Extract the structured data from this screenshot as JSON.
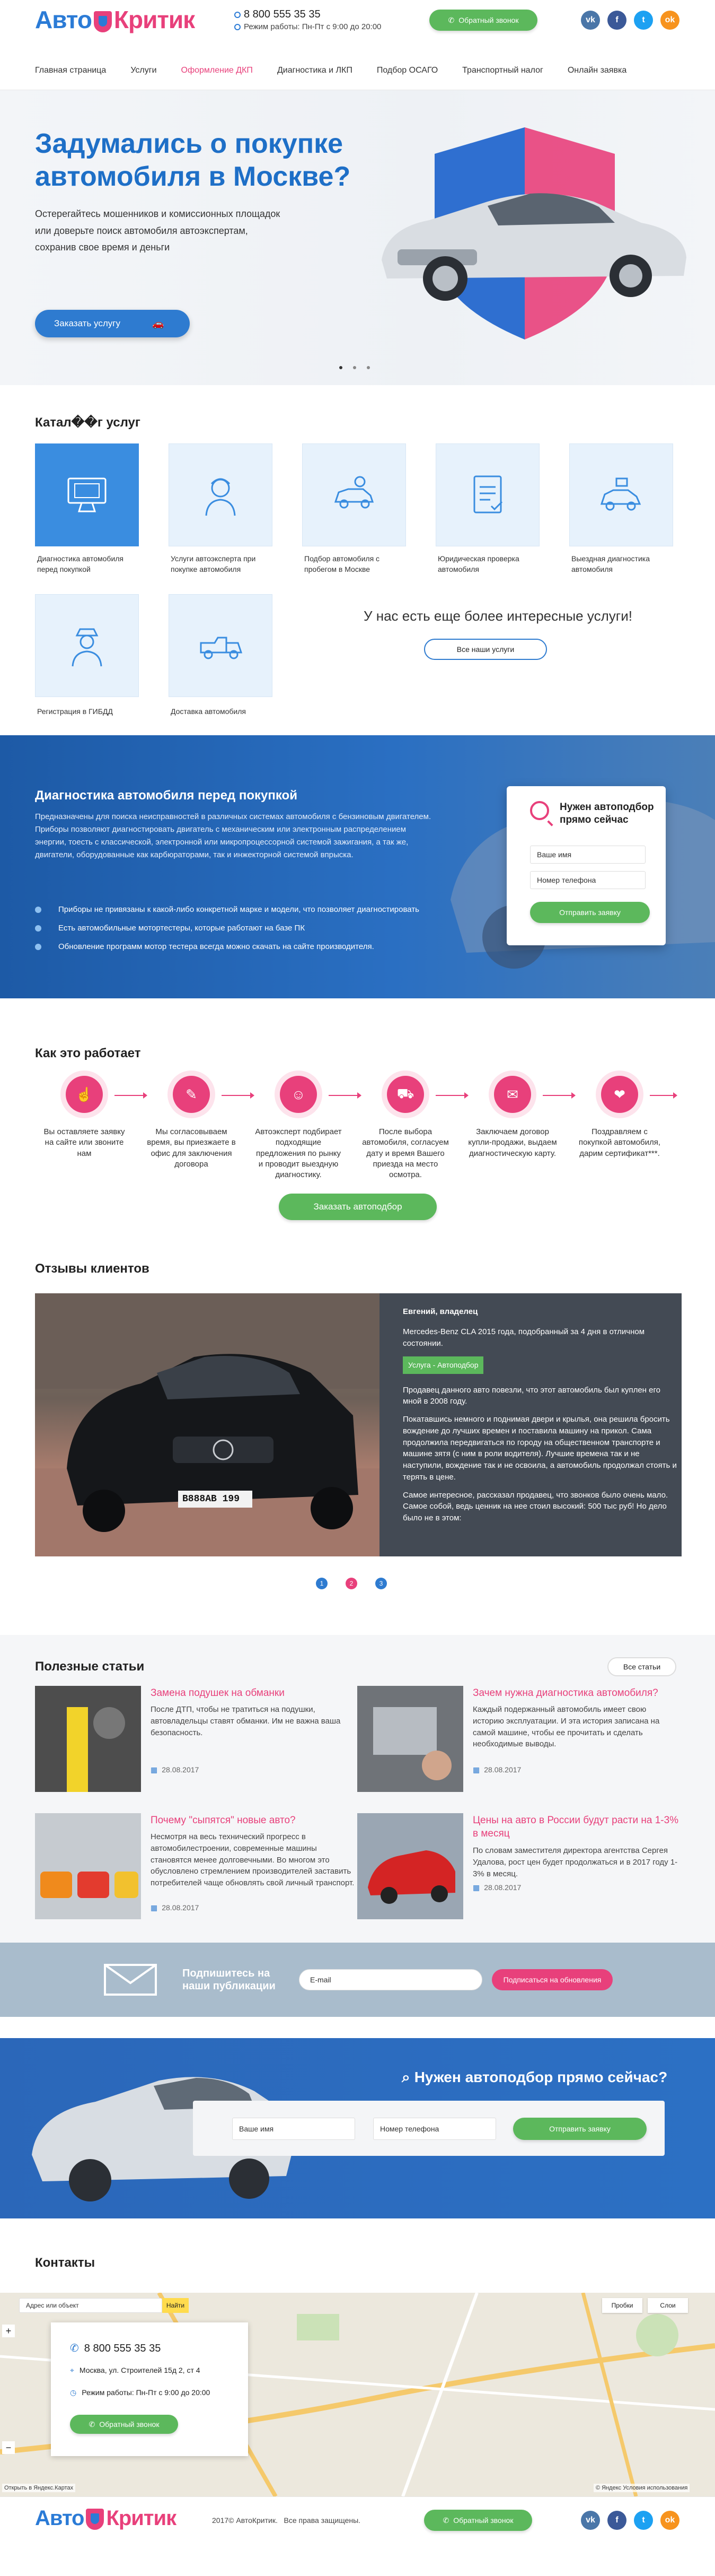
{
  "brand": {
    "part1": "Авто",
    "part2": "Критик"
  },
  "header": {
    "phone": "8 800 555 35 35",
    "hours": "Режим работы: Пн-Пт с 9:00 до 20:00",
    "callback": "Обратный звонок"
  },
  "social": [
    {
      "label": "vk",
      "color": "#4a76a8"
    },
    {
      "label": "f",
      "color": "#3b5998"
    },
    {
      "label": "t",
      "color": "#1da1f2"
    },
    {
      "label": "ok",
      "color": "#f7931e"
    }
  ],
  "nav": [
    "Главная страница",
    "Услуги",
    "Оформление ДКП",
    "Диагностика и ЛКП",
    "Подбор ОСАГО",
    "Транспортный налог",
    "Онлайн заявка"
  ],
  "nav_active": 2,
  "hero": {
    "title": "Задумались о покупке автомобиля в Москве?",
    "text": "Остерегайтесь мошенников и комиссионных площадок или доверьте поиск автомобиля автоэкспертам, сохранив свое время и деньги",
    "button": "Заказать услугу"
  },
  "catalog": {
    "title": "Катал��г услуг",
    "items": [
      "Диагностика автомобиля перед покупкой",
      "Услуги автоэксперта при покупке автомобиля",
      "Подбор автомобиля с пробегом в Москве",
      "Юридическая проверка автомобиля",
      "Выездная диагностика автомобиля",
      "Регистрация в ГИБДД",
      "Доставка автомобиля"
    ],
    "more_text": "У нас есть еще более интересные услуги!",
    "more_button": "Все наши услуги"
  },
  "diag": {
    "title": "Диагностика автомобиля перед покупкой",
    "text": "Предназначены для поиска неисправностей в различных системах автомобиля с бензиновым двигателем. Приборы позволяют диагностировать двигатель с механическим или электронным распределением энергии, тоесть с классической, электронной или микропроцессорной системой зажигания, а так же, двигатели, оборудованные как карбюраторами, так и инжекторной системой впрыска.",
    "bullets": [
      "Приборы не привязаны к какой-либо конкретной марке и модели, что позволяет диагностировать",
      "Есть автомобильные мотортестеры, которые работают на базе ПК",
      "Обновление программ мотор тестера всегда можно скачать на сайте производителя."
    ],
    "form_title": "Нужен автоподбор прямо сейчас",
    "name_ph": "Ваше имя",
    "phone_ph": "Номер телефона",
    "submit": "Отправить заявку"
  },
  "how": {
    "title": "Как это работает",
    "steps": [
      "Вы оставляете заявку на сайте или звоните нам",
      "Мы согласовываем время, вы приезжаете в офис для заключения договора",
      "Автоэксперт подбирает подходящие предложения по рынку и проводит выездную диагностику.",
      "После выбора автомобиля, согласуем дату и время Вашего приезда на место осмотра.",
      "Заключаем договор купли-продажи, выдаем диагностическую карту.",
      "Поздравляем с покупкой автомобиля, дарим сертификат***."
    ],
    "button": "Заказать автоподбор"
  },
  "reviews": {
    "title": "Отзывы клиентов",
    "author": "Евгений, владелец",
    "subtitle": "Mercedes-Benz CLA 2015 года, подобранный за 4 дня в отличном состоянии.",
    "service": "Услуга - Автоподбор",
    "paragraphs": [
      "Продавец данного авто повезли, что этот автомобиль был куплен его мной в 2008 году.",
      "Покатавшись немного и поднимая двери и крылья, она решила бросить вождение до лучших времен и поставила машину на прикол. Сама продолжила передвигаться по городу на общественном транспорте и машине зятя (с ним в роли водителя). Лучшие времена так и не наступили, вождение так и не освоила, а автомобиль продолжал стоять и терять в цене.",
      "Самое интересное, рассказал продавец, что звонков было очень мало. Самое собой, ведь ценник на нее стоил высокий: 500 тыс руб! Но дело было не в этом:"
    ],
    "plate": "В888АВ 199",
    "pages": [
      "1",
      "2",
      "3"
    ]
  },
  "articles": {
    "title": "Полезные статьи",
    "all": "Все статьи",
    "items": [
      {
        "title": "Замена подушек на обманки",
        "text": "После ДТП, чтобы не тратиться на подушки, автовладельцы ставят обманки. Им не важна ваша безопасность.",
        "date": "28.08.2017"
      },
      {
        "title": "Зачем нужна диагностика автомобиля?",
        "text": "Каждый подержанный автомобиль имеет свою историю эксплуатации. И эта история записана на самой машине, чтобы ее прочитать и сделать необходимые выводы.",
        "date": "28.08.2017"
      },
      {
        "title": "Почему \"сыпятся\" новые авто?",
        "text": "Несмотря на весь технический прогресс в автомобилестроении, современные машины становятся менее долговечными. Во многом это обусловлено стремлением производителей заставить потребителей чаще обновлять свой личный транспорт.",
        "date": "28.08.2017"
      },
      {
        "title": "Цены на авто в России будут расти на 1-3% в месяц",
        "text": "По словам заместителя директора агентства Сергея Удалова, рост цен будет продолжаться и в 2017 году 1-3% в месяц.",
        "date": "28.08.2017"
      }
    ]
  },
  "subscribe": {
    "text": "Подпишитесь на наши публикации",
    "email_ph": "E-mail",
    "button": "Подписаться на обновления"
  },
  "cta": {
    "title": "Нужен автоподбор прямо сейчас?",
    "name_ph": "Ваше имя",
    "phone_ph": "Номер телефона",
    "button": "Отправить заявку"
  },
  "contacts": {
    "title": "Контакты",
    "phone": "8 800 555 35 35",
    "address": "Москва, ул. Строителей 15д 2, ст 4",
    "hours": "Режим работы: Пн-Пт с 9:00 до 20:00",
    "callback": "Обратный звонок",
    "map_search": "Адрес или объект",
    "map_find": "Найти",
    "map_traffic": "Пробки",
    "map_layers": "Слои",
    "map_attr": "© Яндекс Условия использования",
    "map_open": "Открыть в Яндекс.Картах"
  },
  "footer": {
    "copyright": "2017© АвтоКритик.",
    "rights": "Все права защищены.",
    "callback": "Обратный звонок"
  }
}
